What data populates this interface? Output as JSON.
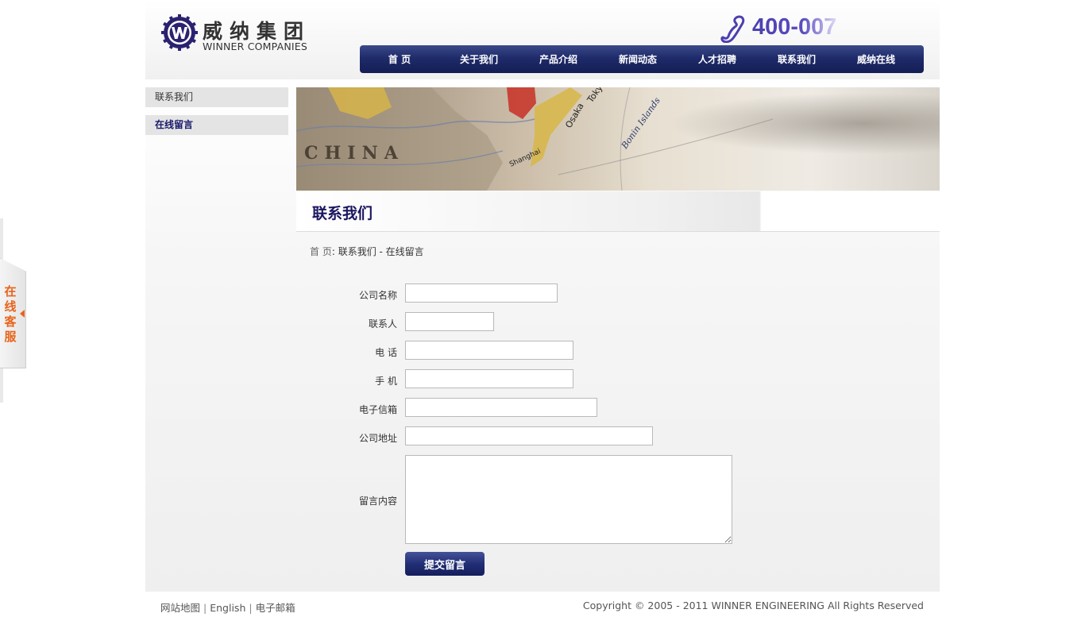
{
  "header": {
    "logo_cn": "威纳集团",
    "logo_en": "WINNER COMPANIES",
    "phone": "400-007"
  },
  "nav": {
    "items": [
      {
        "label": "首 页"
      },
      {
        "label": "关于我们"
      },
      {
        "label": "产品介绍"
      },
      {
        "label": "新闻动态"
      },
      {
        "label": "人才招聘"
      },
      {
        "label": "联系我们"
      },
      {
        "label": "威纳在线"
      }
    ]
  },
  "sidebar": {
    "items": [
      {
        "label": "联系我们"
      },
      {
        "label": "在线留言"
      }
    ]
  },
  "banner": {
    "map_labels": [
      "CHINA",
      "Tokyo",
      "Osaka",
      "Bonin Islands",
      "Shanghai"
    ]
  },
  "page": {
    "title": "联系我们",
    "breadcrumb_home": "首 页",
    "breadcrumb_sep": ":",
    "breadcrumb_path": "联系我们 - 在线留言"
  },
  "form": {
    "company": {
      "label": "公司名称",
      "value": ""
    },
    "contact": {
      "label": "联系人",
      "value": ""
    },
    "phone": {
      "label": "电 话",
      "value": ""
    },
    "mobile": {
      "label": "手 机",
      "value": ""
    },
    "email": {
      "label": "电子信箱",
      "value": ""
    },
    "address": {
      "label": "公司地址",
      "value": ""
    },
    "message": {
      "label": "留言内容",
      "value": ""
    },
    "submit_label": "提交留言"
  },
  "footer": {
    "links": [
      {
        "label": "网站地图"
      },
      {
        "label": "English"
      },
      {
        "label": "电子邮箱"
      }
    ],
    "separator": "|",
    "copyright": "Copyright © 2005 - 2011 WINNER ENGINEERING All Rights Reserved"
  },
  "float_service": {
    "label": "在线客服"
  },
  "colors": {
    "nav_bg": "#1f2b6a",
    "title_color": "#1a1660",
    "accent_orange": "#e8641a"
  }
}
